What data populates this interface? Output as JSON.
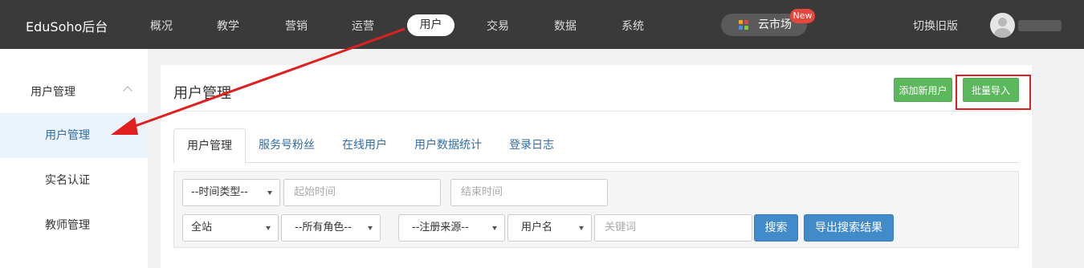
{
  "topbar": {
    "brand": "EduSoho后台",
    "nav": [
      "概况",
      "教学",
      "营销",
      "运营",
      "用户",
      "交易",
      "数据",
      "系统"
    ],
    "active_nav": "用户",
    "market_label": "云市场",
    "new_badge": "New",
    "switch_old": "切换旧版"
  },
  "sidebar": {
    "group_title": "用户管理",
    "items": [
      {
        "label": "用户管理",
        "active": true
      },
      {
        "label": "实名认证",
        "active": false
      },
      {
        "label": "教师管理",
        "active": false
      }
    ]
  },
  "main": {
    "title": "用户管理",
    "add_user_label": "添加新用户",
    "batch_import_label": "批量导入",
    "tabs": [
      "用户管理",
      "服务号粉丝",
      "在线用户",
      "用户数据统计",
      "登录日志"
    ],
    "filters": {
      "time_type": "--时间类型--",
      "start_placeholder": "起始时间",
      "range_dash": "-",
      "end_placeholder": "结束时间",
      "site": "全站",
      "role": "--所有角色--",
      "source": "--注册来源--",
      "field": "用户名",
      "keyword_placeholder": "关键词",
      "search_label": "搜索",
      "export_label": "导出搜索结果"
    }
  },
  "colors": {
    "topbar_bg": "#3a3a3a",
    "green": "#5cb85c",
    "blue": "#428bca",
    "link": "#2f6ea8",
    "annotation_red": "#e02020",
    "badge_red": "#e8453c"
  }
}
